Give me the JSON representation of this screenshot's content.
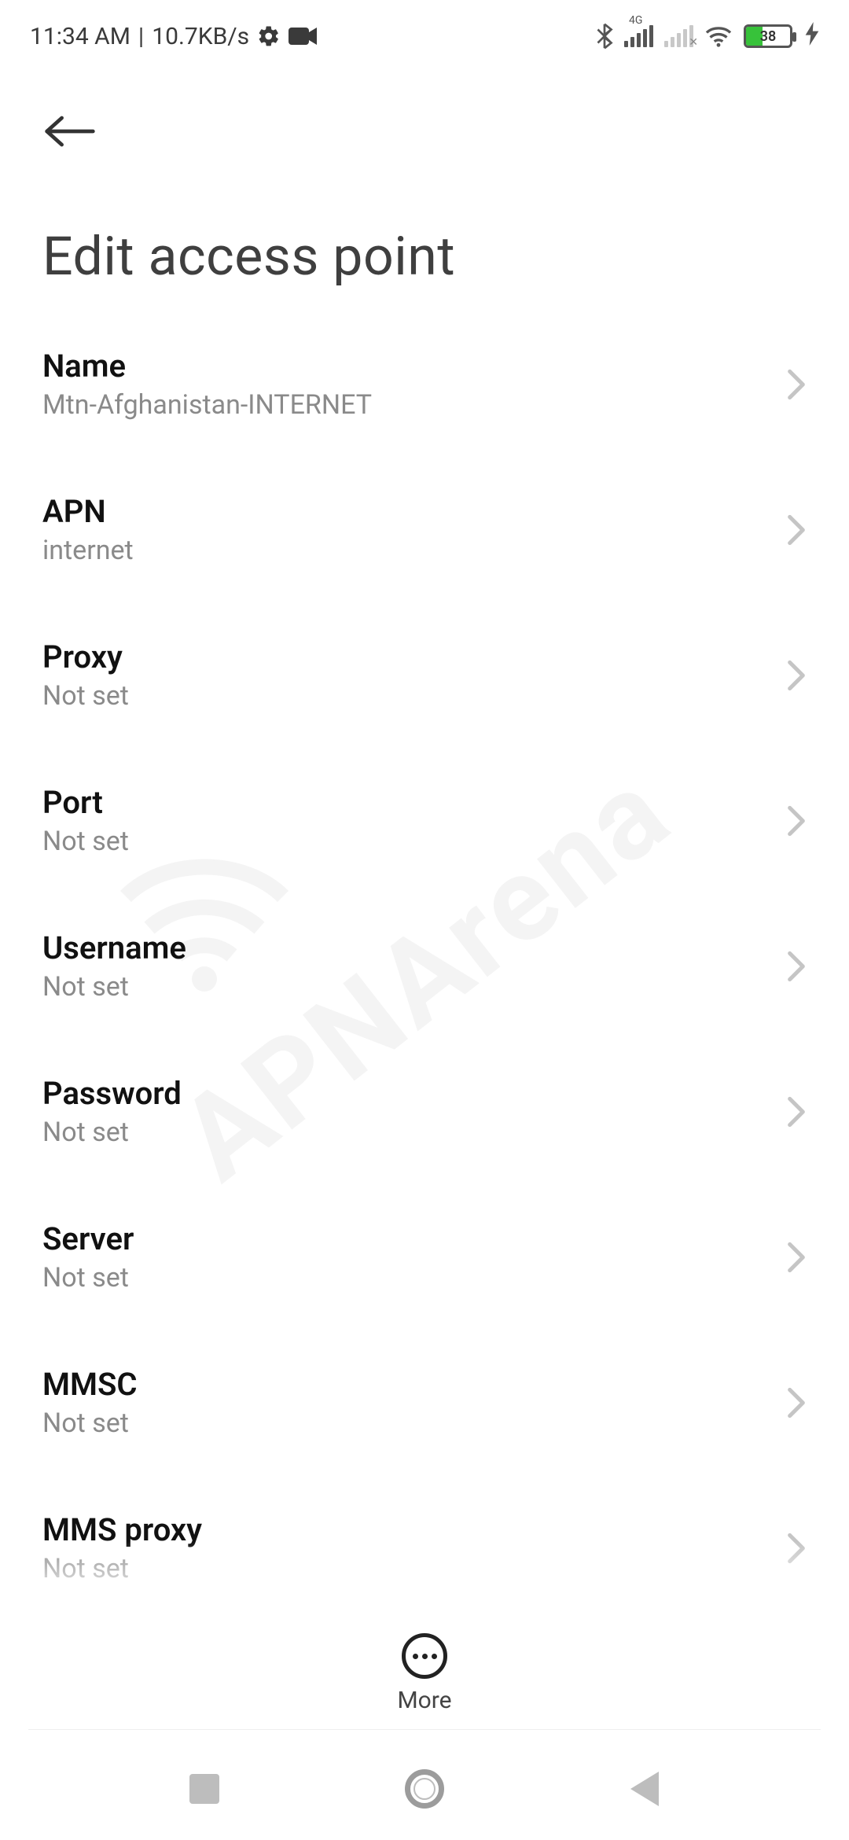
{
  "status": {
    "time": "11:34 AM",
    "net_speed": "10.7KB/s",
    "network_type": "4G",
    "battery_percent": "38"
  },
  "header": {
    "title": "Edit access point"
  },
  "settings": [
    {
      "label": "Name",
      "value": "Mtn-Afghanistan-INTERNET"
    },
    {
      "label": "APN",
      "value": "internet"
    },
    {
      "label": "Proxy",
      "value": "Not set"
    },
    {
      "label": "Port",
      "value": "Not set"
    },
    {
      "label": "Username",
      "value": "Not set"
    },
    {
      "label": "Password",
      "value": "Not set"
    },
    {
      "label": "Server",
      "value": "Not set"
    },
    {
      "label": "MMSC",
      "value": "Not set"
    },
    {
      "label": "MMS proxy",
      "value": "Not set"
    }
  ],
  "bottom": {
    "more_label": "More"
  },
  "watermark": "APNArena"
}
